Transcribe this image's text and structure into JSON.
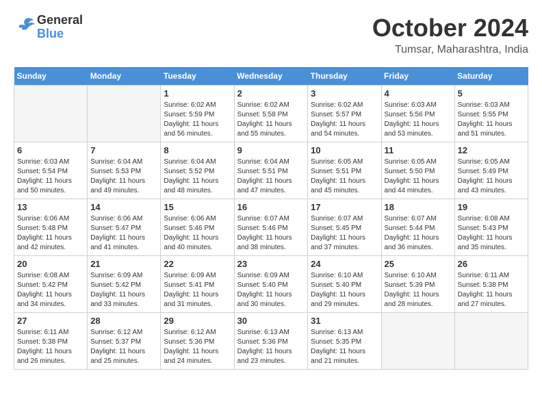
{
  "logo": {
    "text_general": "General",
    "text_blue": "Blue"
  },
  "header": {
    "month": "October 2024",
    "location": "Tumsar, Maharashtra, India"
  },
  "weekdays": [
    "Sunday",
    "Monday",
    "Tuesday",
    "Wednesday",
    "Thursday",
    "Friday",
    "Saturday"
  ],
  "weeks": [
    [
      {
        "day": "",
        "info": ""
      },
      {
        "day": "",
        "info": ""
      },
      {
        "day": "1",
        "info": "Sunrise: 6:02 AM\nSunset: 5:59 PM\nDaylight: 11 hours and 56 minutes."
      },
      {
        "day": "2",
        "info": "Sunrise: 6:02 AM\nSunset: 5:58 PM\nDaylight: 11 hours and 55 minutes."
      },
      {
        "day": "3",
        "info": "Sunrise: 6:02 AM\nSunset: 5:57 PM\nDaylight: 11 hours and 54 minutes."
      },
      {
        "day": "4",
        "info": "Sunrise: 6:03 AM\nSunset: 5:56 PM\nDaylight: 11 hours and 53 minutes."
      },
      {
        "day": "5",
        "info": "Sunrise: 6:03 AM\nSunset: 5:55 PM\nDaylight: 11 hours and 51 minutes."
      }
    ],
    [
      {
        "day": "6",
        "info": "Sunrise: 6:03 AM\nSunset: 5:54 PM\nDaylight: 11 hours and 50 minutes."
      },
      {
        "day": "7",
        "info": "Sunrise: 6:04 AM\nSunset: 5:53 PM\nDaylight: 11 hours and 49 minutes."
      },
      {
        "day": "8",
        "info": "Sunrise: 6:04 AM\nSunset: 5:52 PM\nDaylight: 11 hours and 48 minutes."
      },
      {
        "day": "9",
        "info": "Sunrise: 6:04 AM\nSunset: 5:51 PM\nDaylight: 11 hours and 47 minutes."
      },
      {
        "day": "10",
        "info": "Sunrise: 6:05 AM\nSunset: 5:51 PM\nDaylight: 11 hours and 45 minutes."
      },
      {
        "day": "11",
        "info": "Sunrise: 6:05 AM\nSunset: 5:50 PM\nDaylight: 11 hours and 44 minutes."
      },
      {
        "day": "12",
        "info": "Sunrise: 6:05 AM\nSunset: 5:49 PM\nDaylight: 11 hours and 43 minutes."
      }
    ],
    [
      {
        "day": "13",
        "info": "Sunrise: 6:06 AM\nSunset: 5:48 PM\nDaylight: 11 hours and 42 minutes."
      },
      {
        "day": "14",
        "info": "Sunrise: 6:06 AM\nSunset: 5:47 PM\nDaylight: 11 hours and 41 minutes."
      },
      {
        "day": "15",
        "info": "Sunrise: 6:06 AM\nSunset: 5:46 PM\nDaylight: 11 hours and 40 minutes."
      },
      {
        "day": "16",
        "info": "Sunrise: 6:07 AM\nSunset: 5:46 PM\nDaylight: 11 hours and 38 minutes."
      },
      {
        "day": "17",
        "info": "Sunrise: 6:07 AM\nSunset: 5:45 PM\nDaylight: 11 hours and 37 minutes."
      },
      {
        "day": "18",
        "info": "Sunrise: 6:07 AM\nSunset: 5:44 PM\nDaylight: 11 hours and 36 minutes."
      },
      {
        "day": "19",
        "info": "Sunrise: 6:08 AM\nSunset: 5:43 PM\nDaylight: 11 hours and 35 minutes."
      }
    ],
    [
      {
        "day": "20",
        "info": "Sunrise: 6:08 AM\nSunset: 5:42 PM\nDaylight: 11 hours and 34 minutes."
      },
      {
        "day": "21",
        "info": "Sunrise: 6:09 AM\nSunset: 5:42 PM\nDaylight: 11 hours and 33 minutes."
      },
      {
        "day": "22",
        "info": "Sunrise: 6:09 AM\nSunset: 5:41 PM\nDaylight: 11 hours and 31 minutes."
      },
      {
        "day": "23",
        "info": "Sunrise: 6:09 AM\nSunset: 5:40 PM\nDaylight: 11 hours and 30 minutes."
      },
      {
        "day": "24",
        "info": "Sunrise: 6:10 AM\nSunset: 5:40 PM\nDaylight: 11 hours and 29 minutes."
      },
      {
        "day": "25",
        "info": "Sunrise: 6:10 AM\nSunset: 5:39 PM\nDaylight: 11 hours and 28 minutes."
      },
      {
        "day": "26",
        "info": "Sunrise: 6:11 AM\nSunset: 5:38 PM\nDaylight: 11 hours and 27 minutes."
      }
    ],
    [
      {
        "day": "27",
        "info": "Sunrise: 6:11 AM\nSunset: 5:38 PM\nDaylight: 11 hours and 26 minutes."
      },
      {
        "day": "28",
        "info": "Sunrise: 6:12 AM\nSunset: 5:37 PM\nDaylight: 11 hours and 25 minutes."
      },
      {
        "day": "29",
        "info": "Sunrise: 6:12 AM\nSunset: 5:36 PM\nDaylight: 11 hours and 24 minutes."
      },
      {
        "day": "30",
        "info": "Sunrise: 6:13 AM\nSunset: 5:36 PM\nDaylight: 11 hours and 23 minutes."
      },
      {
        "day": "31",
        "info": "Sunrise: 6:13 AM\nSunset: 5:35 PM\nDaylight: 11 hours and 21 minutes."
      },
      {
        "day": "",
        "info": ""
      },
      {
        "day": "",
        "info": ""
      }
    ]
  ]
}
